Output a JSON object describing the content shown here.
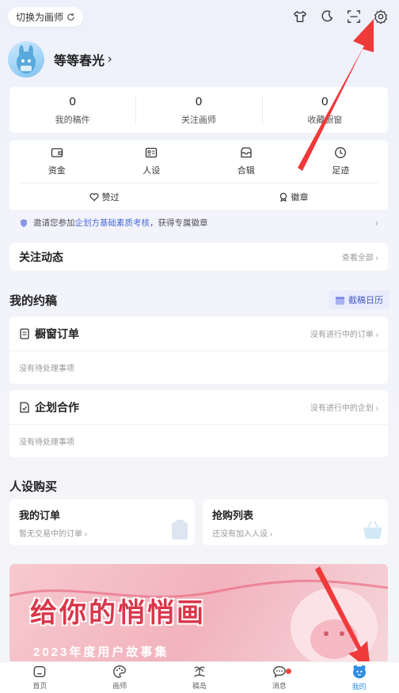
{
  "topbar": {
    "switch_label": "切换为画师",
    "icons": [
      "shirt-icon",
      "moon-icon",
      "scan-icon",
      "gear-icon"
    ]
  },
  "profile": {
    "name": "等等春光"
  },
  "stats": [
    {
      "num": "0",
      "label": "我的稿件"
    },
    {
      "num": "0",
      "label": "关注画师"
    },
    {
      "num": "0",
      "label": "收藏橱窗"
    }
  ],
  "tools": [
    {
      "label": "资金",
      "icon": "wallet-icon"
    },
    {
      "label": "人设",
      "icon": "id-card-icon"
    },
    {
      "label": "合辑",
      "icon": "collection-icon"
    },
    {
      "label": "足迹",
      "icon": "clock-icon"
    }
  ],
  "tools2": [
    {
      "label": "赞过",
      "icon": "heart-icon"
    },
    {
      "label": "徽章",
      "icon": "badge-icon"
    }
  ],
  "notice": {
    "prefix": "邀请您参加 ",
    "highlight": "企划方基础素质考核",
    "suffix": "，获得专属徽章"
  },
  "follow": {
    "title": "关注动态",
    "more": "查看全部"
  },
  "my_orders": {
    "title": "我的约稿",
    "calendar": "截稿日历",
    "cards": [
      {
        "title": "橱窗订单",
        "status": "没有进行中的订单",
        "empty": "没有待处理事项"
      },
      {
        "title": "企划合作",
        "status": "没有进行中的企划",
        "empty": "没有待处理事项"
      }
    ]
  },
  "oc_buy": {
    "title": "人设购买",
    "cards": [
      {
        "title": "我的订单",
        "sub": "暂无交易中的订单"
      },
      {
        "title": "抢购列表",
        "sub": "还没有加入人设"
      }
    ]
  },
  "banner": {
    "title": "给你的悄悄画",
    "sub": "2023年度用户故事集"
  },
  "tabs": [
    {
      "label": "首页",
      "icon": "home-icon"
    },
    {
      "label": "画师",
      "icon": "palette-icon"
    },
    {
      "label": "稿岛",
      "icon": "island-icon"
    },
    {
      "label": "消息",
      "icon": "message-icon"
    },
    {
      "label": "我的",
      "icon": "profile-icon"
    }
  ],
  "colors": {
    "accent": "#2e8de6",
    "link": "#4a6ad8",
    "annotation": "#f03a3a"
  }
}
